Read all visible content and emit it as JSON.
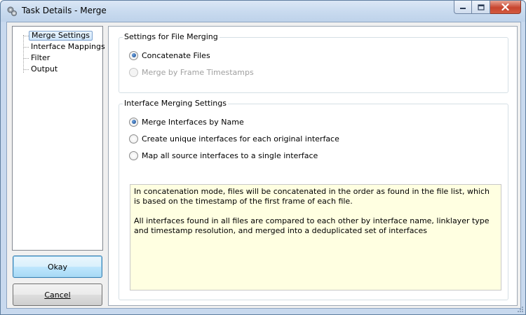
{
  "window": {
    "title": "Task Details - Merge",
    "accent_color": "#c8d9ee",
    "icons": {
      "app": "gear-icon",
      "minimize": "minimize-icon",
      "maximize": "maximize-icon",
      "close": "close-icon"
    }
  },
  "tree": {
    "items": [
      {
        "label": "Merge Settings",
        "selected": true
      },
      {
        "label": "Interface Mappings",
        "selected": false
      },
      {
        "label": "Filter",
        "selected": false
      },
      {
        "label": "Output",
        "selected": false
      }
    ]
  },
  "buttons": {
    "ok_label": "Okay",
    "cancel_label": "Cancel"
  },
  "file_merging": {
    "title": "Settings for File Merging",
    "options": [
      {
        "label": "Concatenate Files",
        "checked": true,
        "enabled": true
      },
      {
        "label": "Merge by Frame Timestamps",
        "checked": false,
        "enabled": false
      }
    ]
  },
  "interface_merging": {
    "title": "Interface Merging Settings",
    "options": [
      {
        "label": "Merge Interfaces by Name",
        "checked": true
      },
      {
        "label": "Create unique interfaces for each original interface",
        "checked": false
      },
      {
        "label": "Map all source interfaces to a single interface",
        "checked": false
      }
    ]
  },
  "info": {
    "paragraph1": "In concatenation mode, files will be concatenated in the order as found in the file list, which is based on the timestamp of the first frame of each file.",
    "paragraph2": "All interfaces found in all files are compared to each other by interface name, linklayer type and timestamp resolution, and merged into a deduplicated set of interfaces",
    "background_color": "#ffffe1"
  }
}
